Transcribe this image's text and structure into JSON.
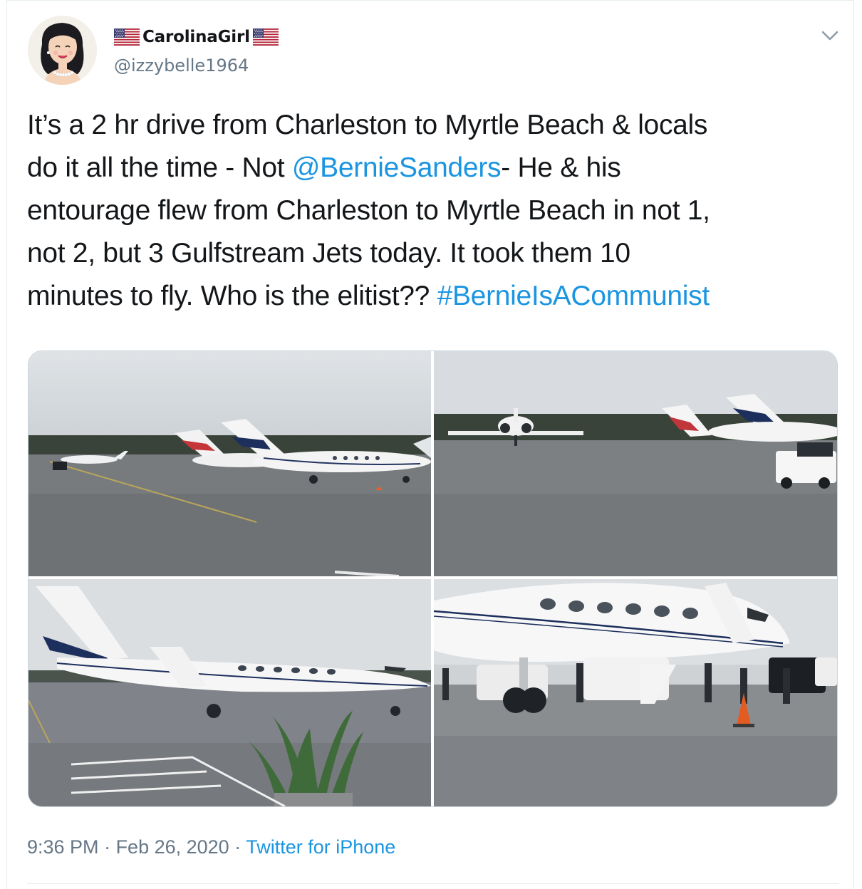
{
  "user": {
    "display_name": "CarolinaGirl",
    "handle": "@izzybelle1964",
    "name_flag_icon": "us-flag-icon"
  },
  "tweet": {
    "lines": [
      [
        {
          "text": "It’s a 2 hr drive from Charleston to Myrtle Beach & locals",
          "type": "text"
        }
      ],
      [
        {
          "text": "do it all the time - Not ",
          "type": "text"
        },
        {
          "text": "@BernieSanders",
          "type": "mention"
        },
        {
          "text": "-  He & his",
          "type": "text"
        }
      ],
      [
        {
          "text": "entourage flew from Charleston to Myrtle Beach in not 1,",
          "type": "text"
        }
      ],
      [
        {
          "text": "not 2, but 3 Gulfstream Jets today. It took them 10",
          "type": "text"
        }
      ],
      [
        {
          "text": "minutes to fly. Who is the elitist?? ",
          "type": "text"
        },
        {
          "text": "#BernieIsACommunist",
          "type": "hashtag"
        }
      ]
    ],
    "photo_count": 4
  },
  "meta": {
    "time": "9:36 PM",
    "separator": " · ",
    "date": "Feb 26, 2020",
    "source": "Twitter for iPhone"
  },
  "icons": {
    "caret": "chevron-down-icon"
  },
  "colors": {
    "link": "#1b95e0",
    "text": "#14171a",
    "secondary": "#657786",
    "border": "#e6ecf0"
  }
}
